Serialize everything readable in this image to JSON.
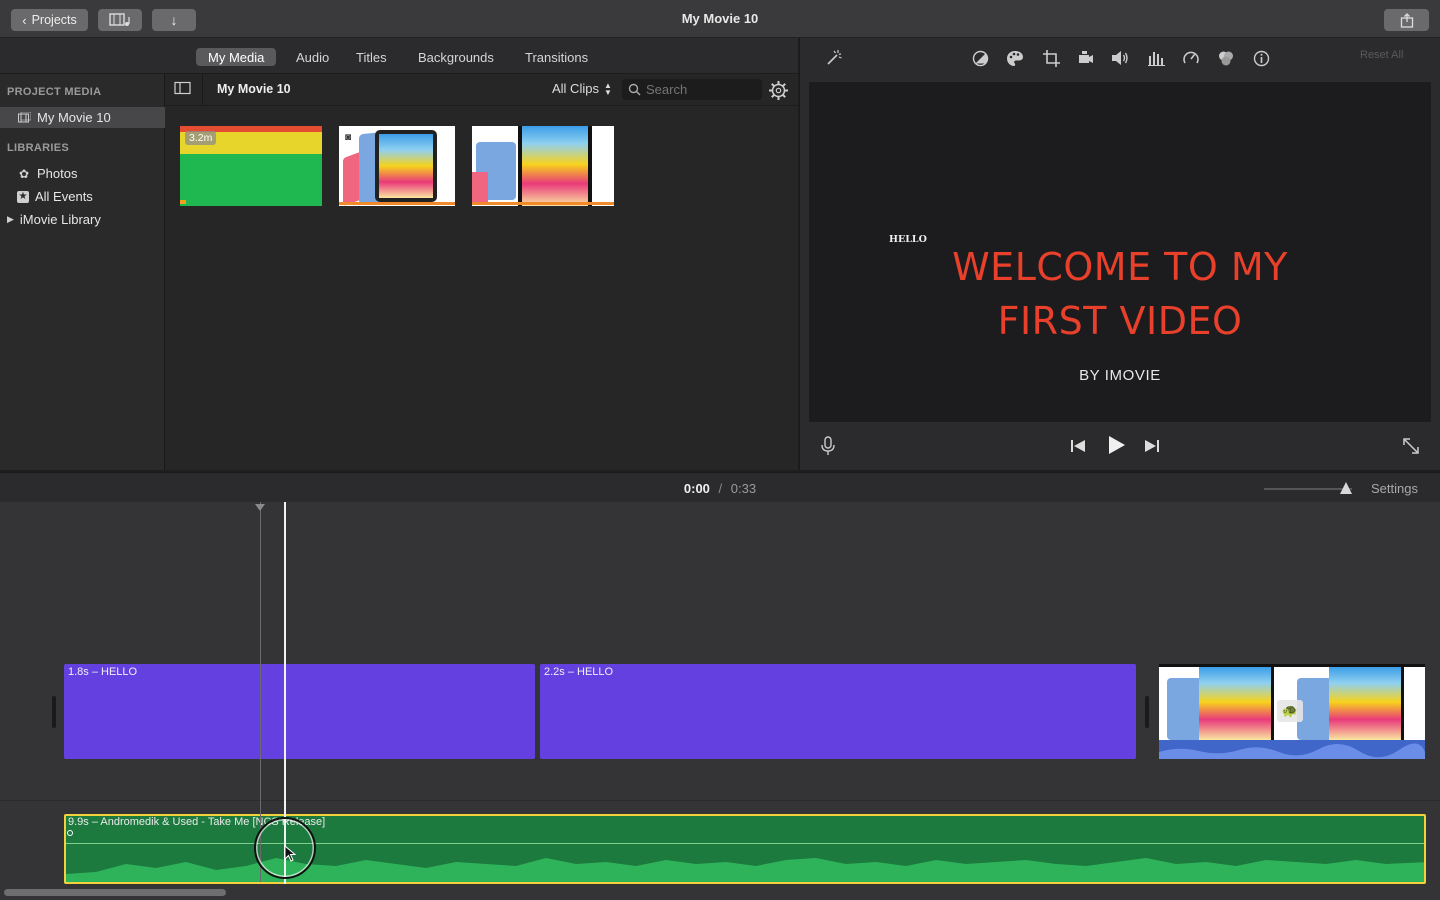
{
  "window": {
    "title": "My Movie 10",
    "projects_label": "Projects"
  },
  "tabs": [
    {
      "label": "My Media",
      "active": true
    },
    {
      "label": "Audio",
      "active": false
    },
    {
      "label": "Titles",
      "active": false
    },
    {
      "label": "Backgrounds",
      "active": false
    },
    {
      "label": "Transitions",
      "active": false
    }
  ],
  "sidebar": {
    "project_media_heading": "PROJECT MEDIA",
    "project_item": "My Movie 10",
    "libraries_heading": "LIBRARIES",
    "items": [
      {
        "label": "Photos",
        "icon": "photos-icon"
      },
      {
        "label": "All Events",
        "icon": "star-icon"
      },
      {
        "label": "iMovie Library",
        "icon": "disclosure-triangle-icon"
      }
    ]
  },
  "media": {
    "event_title": "My Movie 10",
    "filter_label": "All Clips",
    "search_placeholder": "Search",
    "thumbs": [
      {
        "badge": "3.2m",
        "kind": "green-title"
      },
      {
        "badge": "",
        "kind": "ipad-photo"
      },
      {
        "badge": "",
        "kind": "ipad-video"
      }
    ]
  },
  "viewer": {
    "reset_all": "Reset All",
    "small_text": "HELLO",
    "headline_line1": "WELCOME TO MY",
    "headline_line2": "FIRST VIDEO",
    "subtitle": "BY IMOVIE",
    "headline_color": "#e8402a"
  },
  "timeline": {
    "current_time": "0:00",
    "separator": "/",
    "total_time": "0:33",
    "settings_label": "Settings",
    "clips": [
      {
        "label": "1.8s – HELLO"
      },
      {
        "label": "2.2s – HELLO"
      }
    ],
    "audio_clip": {
      "label": "9.9s – Andromedik & Used - Take Me [NCS Release]"
    }
  },
  "colors": {
    "accent_purple": "#6440e0",
    "audio_green": "#1c7a3e",
    "selection_yellow": "#f2d13c"
  }
}
